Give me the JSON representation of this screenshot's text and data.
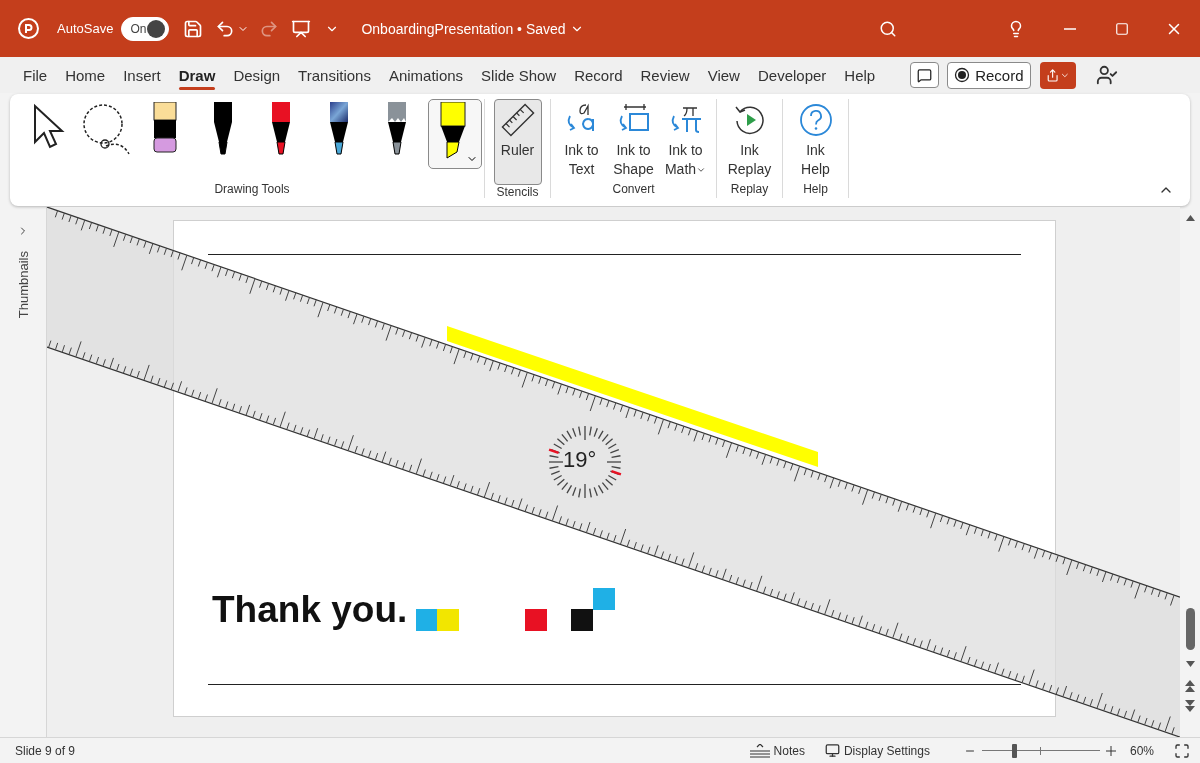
{
  "title_bar": {
    "autosave": {
      "label": "AutoSave",
      "state_text": "On",
      "on": true
    },
    "document_title": "OnboardingPresentation • Saved"
  },
  "tabs": [
    {
      "label": "File",
      "selected": false
    },
    {
      "label": "Home",
      "selected": false
    },
    {
      "label": "Insert",
      "selected": false
    },
    {
      "label": "Draw",
      "selected": true
    },
    {
      "label": "Design",
      "selected": false
    },
    {
      "label": "Transitions",
      "selected": false
    },
    {
      "label": "Animations",
      "selected": false
    },
    {
      "label": "Slide Show",
      "selected": false
    },
    {
      "label": "Record",
      "selected": false
    },
    {
      "label": "Review",
      "selected": false
    },
    {
      "label": "View",
      "selected": false
    },
    {
      "label": "Developer",
      "selected": false
    },
    {
      "label": "Help",
      "selected": false
    }
  ],
  "record_button": "Record",
  "drawing_tools": {
    "label": "Drawing Tools",
    "tools": [
      {
        "kind": "select",
        "selected": false
      },
      {
        "kind": "lasso",
        "selected": false
      },
      {
        "kind": "eraser",
        "selected": false
      },
      {
        "kind": "pen",
        "color": "#000000",
        "selected": false
      },
      {
        "kind": "pen",
        "color": "#e81123",
        "selected": false
      },
      {
        "kind": "galaxy",
        "selected": false
      },
      {
        "kind": "pencil",
        "color": "#8a9299",
        "selected": false
      },
      {
        "kind": "highlighter",
        "color": "#ffff00",
        "selected": true
      }
    ]
  },
  "stencils": {
    "label": "Stencils",
    "ruler": {
      "label": "Ruler",
      "selected": true
    }
  },
  "convert": {
    "label": "Convert",
    "buttons": [
      {
        "kind": "text",
        "label": "Ink to Text"
      },
      {
        "kind": "shape",
        "label": "Ink to Shape"
      },
      {
        "kind": "math",
        "label": "Ink to Math",
        "has_menu": true
      }
    ]
  },
  "replay": {
    "label": "Replay",
    "button": "Ink Replay"
  },
  "help": {
    "label": "Help",
    "button": "Ink Help"
  },
  "thumbnails": {
    "label": "Thumbnails"
  },
  "slide": {
    "title": "Thank you.",
    "squares": [
      {
        "color": "#1fb0e6"
      },
      {
        "color": "#f2e600"
      },
      {
        "color": "#e81123"
      },
      {
        "color": "#111111"
      },
      {
        "color": "#1fb0e6"
      }
    ]
  },
  "ruler": {
    "angle": "19°"
  },
  "status_bar": {
    "slide_indicator": "Slide 9 of 9",
    "notes": "Notes",
    "display_settings": "Display Settings",
    "zoom": {
      "level": 0.27,
      "reading": "60%"
    }
  }
}
